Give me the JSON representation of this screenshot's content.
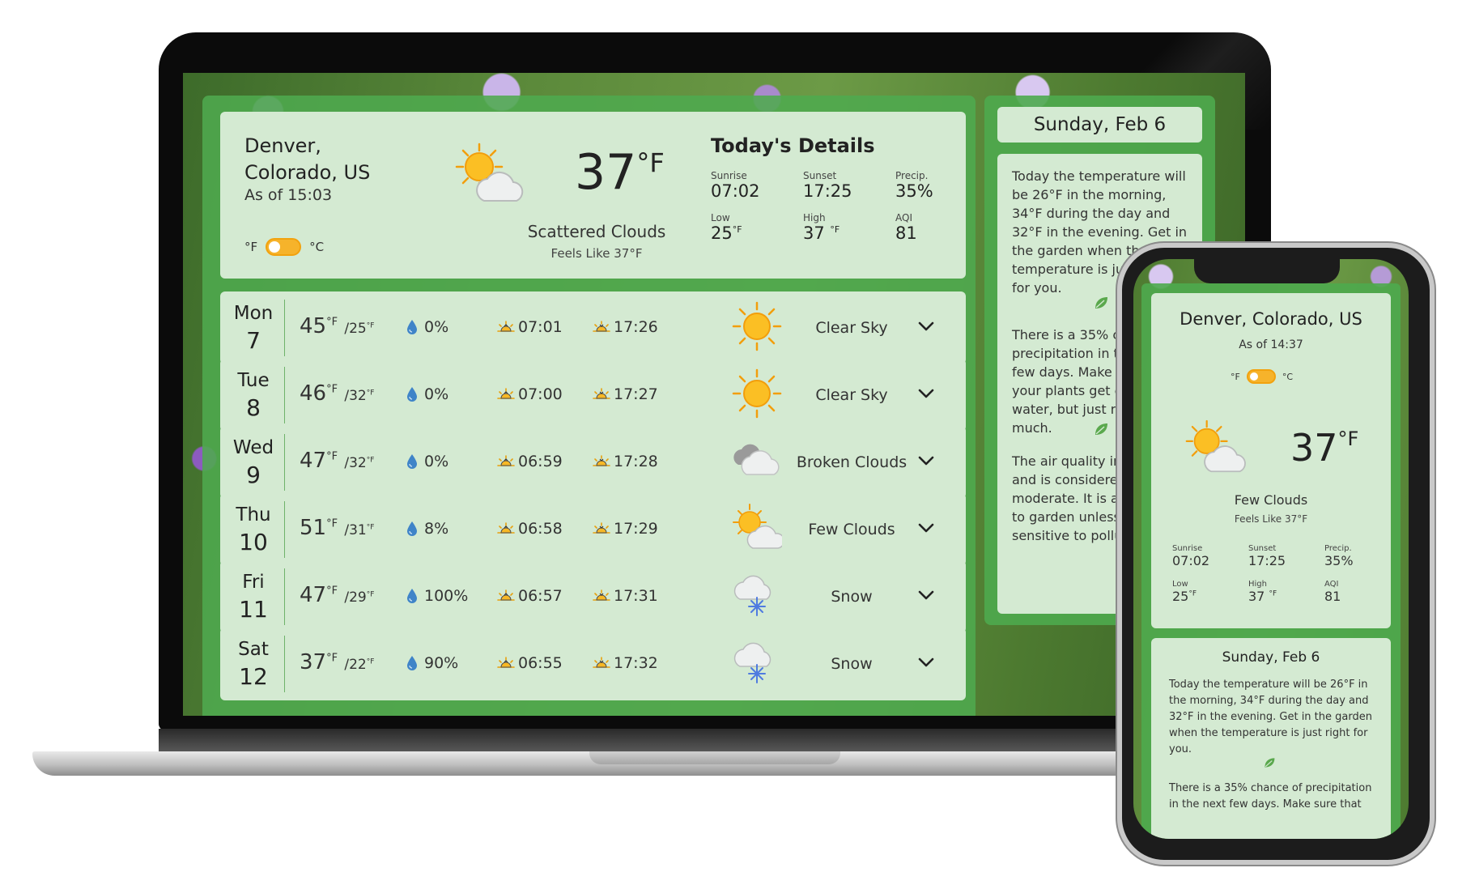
{
  "desktop": {
    "header": {
      "location_line1": "Denver,",
      "location_line2": "Colorado, US",
      "as_of": "As of 15:03",
      "unit_f": "°F",
      "unit_c": "°C",
      "temp": "37",
      "temp_unit": "°F",
      "condition": "Scattered Clouds",
      "feels_like": "Feels Like 37°F",
      "icon": "sun-cloud-icon"
    },
    "details": {
      "title": "Today's Details",
      "items": [
        {
          "label": "Sunrise",
          "value": "07:02",
          "unit": ""
        },
        {
          "label": "Sunset",
          "value": "17:25",
          "unit": ""
        },
        {
          "label": "Precip.",
          "value": "35%",
          "unit": ""
        },
        {
          "label": "Low",
          "value": "25",
          "unit": "°F"
        },
        {
          "label": "High",
          "value": "37 ",
          "unit": "°F"
        },
        {
          "label": "AQI",
          "value": "81",
          "unit": ""
        }
      ]
    },
    "forecast": [
      {
        "day": "Mon",
        "date": "7",
        "high": "45",
        "low": "/25",
        "unit": "°F",
        "precip": "0%",
        "sunrise": "07:01",
        "sunset": "17:26",
        "condition": "Clear Sky",
        "icon": "sun-icon"
      },
      {
        "day": "Tue",
        "date": "8",
        "high": "46",
        "low": "/32",
        "unit": "°F",
        "precip": "0%",
        "sunrise": "07:00",
        "sunset": "17:27",
        "condition": "Clear Sky",
        "icon": "sun-icon"
      },
      {
        "day": "Wed",
        "date": "9",
        "high": "47",
        "low": "/32",
        "unit": "°F",
        "precip": "0%",
        "sunrise": "06:59",
        "sunset": "17:28",
        "condition": "Broken Clouds",
        "icon": "clouds-icon"
      },
      {
        "day": "Thu",
        "date": "10",
        "high": "51",
        "low": "/31",
        "unit": "°F",
        "precip": "8%",
        "sunrise": "06:58",
        "sunset": "17:29",
        "condition": "Few Clouds",
        "icon": "sun-cloud-icon"
      },
      {
        "day": "Fri",
        "date": "11",
        "high": "47",
        "low": "/29",
        "unit": "°F",
        "precip": "100%",
        "sunrise": "06:57",
        "sunset": "17:31",
        "condition": "Snow",
        "icon": "snow-icon"
      },
      {
        "day": "Sat",
        "date": "12",
        "high": "37",
        "low": "/22",
        "unit": "°F",
        "precip": "90%",
        "sunrise": "06:55",
        "sunset": "17:32",
        "condition": "Snow",
        "icon": "snow-icon"
      }
    ],
    "summary": {
      "date": "Sunday, Feb 6",
      "p1": "Today the temperature will be 26°F in the morning, 34°F during the day and 32°F in the evening. Get in the garden when the temperature is just right for you.",
      "p2": "There is a 35% chance of precipitation in the next few days. Make sure that your plants get enough water, but just not too much.",
      "p3": "The air quality index is 81 and is considered moderate. It is a good day to garden unless you are sensitive to pollution."
    }
  },
  "mobile": {
    "location": "Denver, Colorado, US",
    "as_of": "As of 14:37",
    "unit_f": "°F",
    "unit_c": "°C",
    "temp": "37",
    "temp_unit": "°F",
    "condition": "Few Clouds",
    "feels_like": "Feels Like 37°F",
    "details": [
      {
        "label": "Sunrise",
        "value": "07:02",
        "unit": ""
      },
      {
        "label": "Sunset",
        "value": "17:25",
        "unit": ""
      },
      {
        "label": "Precip.",
        "value": "35%",
        "unit": ""
      },
      {
        "label": "Low",
        "value": "25",
        "unit": "°F"
      },
      {
        "label": "High",
        "value": "37 ",
        "unit": "°F"
      },
      {
        "label": "AQI",
        "value": "81",
        "unit": ""
      }
    ],
    "summary_date": "Sunday, Feb 6",
    "summary_p1": "Today the temperature will be 26°F in the morning, 34°F during the day and 32°F in the evening. Get in the garden when the temperature is just right for you.",
    "summary_p2": "There is a 35% chance of precipitation in the next few days. Make sure that"
  },
  "colors": {
    "panel_green": "#4eaa4e",
    "card_mint": "#d4ead2",
    "toggle_orange": "#f6b32b",
    "sun_yellow": "#fbbf24"
  }
}
